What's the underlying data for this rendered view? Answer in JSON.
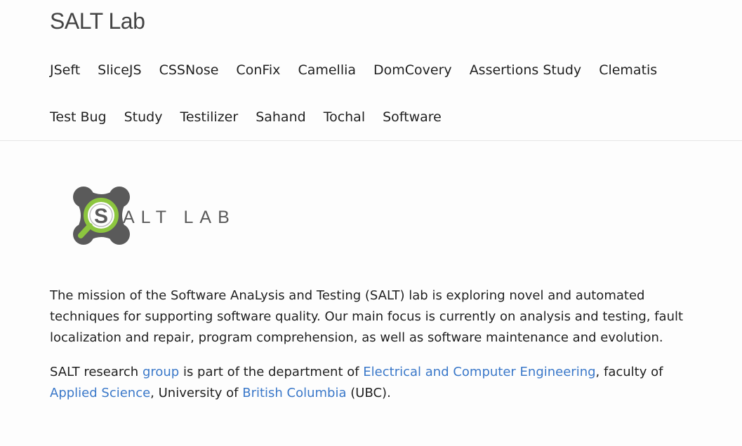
{
  "header": {
    "site_title": "SALT Lab",
    "nav_items": [
      "JSeft",
      "SliceJS",
      "CSSNose",
      "ConFix",
      "Camellia",
      "DomCovery",
      "Assertions Study",
      "Clematis",
      "Test Bug",
      "Study",
      "Testilizer",
      "Sahand",
      "Tochal",
      "Software"
    ]
  },
  "logo": {
    "text": "SALT LAB",
    "icon": "salt-lab-logo",
    "colors": {
      "gray": "#5a5a5a",
      "green": "#8cc63f"
    }
  },
  "main": {
    "mission": "The mission of the Software AnaLysis and Testing (SALT) lab is exploring novel and automated techniques for supporting software quality. Our main focus is currently on analysis and testing, fault localization and repair, program comprehension, as well as software maintenance and evolution.",
    "affiliation": {
      "t1": "SALT research ",
      "link_group": "group",
      "t2": " is part of the department of ",
      "link_ece": "Electrical and Computer Engineering",
      "t3": ", faculty of ",
      "link_applied_science": "Applied Science",
      "t4": ", University of ",
      "link_bc": "British Columbia",
      "t5": " (UBC)."
    }
  },
  "colors": {
    "link": "#3a78c9",
    "text": "#1f1f1f",
    "border": "#e6e6e6"
  }
}
